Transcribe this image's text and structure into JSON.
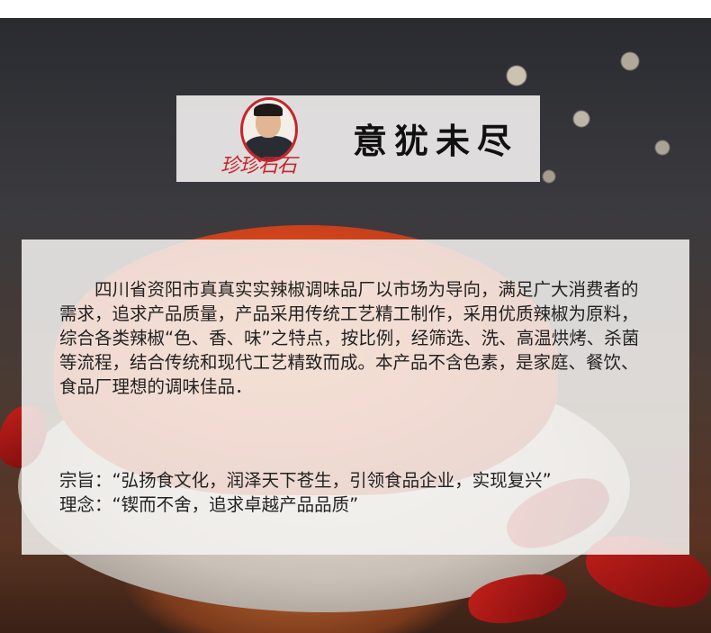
{
  "brand": {
    "logo_text": "珍珍石石"
  },
  "heading": "意犹未尽",
  "description": "四川省资阳市真真实实辣椒调味品厂以市场为导向，满足广大消费者的需求，追求产品质量，产品采用传统工艺精工制作，采用优质辣椒为原料，综合各类辣椒“色、香、味”之特点，按比例，经筛选、洗、高温烘烤、杀菌等流程，结合传统和现代工艺精致而成。本产品不含色素，是家庭、餐饮、食品厂理想的调味佳品．",
  "tenets": [
    "宗旨：“弘扬食文化，润泽天下苍生，引领食品企业，实现复兴”",
    "理念：“锲而不舍，追求卓越产品品质”"
  ],
  "colors": {
    "brand_red": "#c9232a",
    "panel": "#f5f3f1",
    "chili_powder": "#e0511e"
  }
}
